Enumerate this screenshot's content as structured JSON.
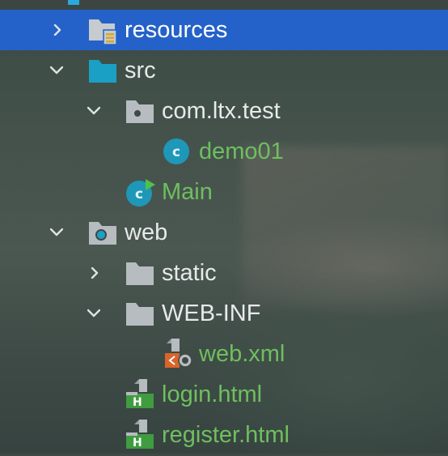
{
  "tree": {
    "items": [
      {
        "label": "resources",
        "icon": "resources-folder-icon",
        "color": "#ffffff",
        "expand": "collapsed",
        "selected": true
      },
      {
        "label": "src",
        "icon": "source-folder-icon",
        "color": "#e7e9ea",
        "expand": "expanded"
      },
      {
        "label": "com.ltx.test",
        "icon": "package-icon",
        "color": "#e7e9ea",
        "expand": "expanded"
      },
      {
        "label": "demo01",
        "icon": "class-icon",
        "color": "#6fbf5f",
        "expand": "none"
      },
      {
        "label": "Main",
        "icon": "main-class-icon",
        "color": "#6fbf5f",
        "expand": "none"
      },
      {
        "label": "web",
        "icon": "web-folder-icon",
        "color": "#e7e9ea",
        "expand": "expanded"
      },
      {
        "label": "static",
        "icon": "folder-icon",
        "color": "#e7e9ea",
        "expand": "collapsed"
      },
      {
        "label": "WEB-INF",
        "icon": "folder-icon",
        "color": "#e7e9ea",
        "expand": "expanded"
      },
      {
        "label": "web.xml",
        "icon": "xml-file-icon",
        "color": "#6fbf5f",
        "expand": "none"
      },
      {
        "label": "login.html",
        "icon": "html-file-icon",
        "color": "#6fbf5f",
        "expand": "none"
      },
      {
        "label": "register.html",
        "icon": "html-file-icon",
        "color": "#6fbf5f",
        "expand": "none"
      }
    ]
  },
  "colors": {
    "selection": "#2462c9",
    "folder": "#b7bcc0",
    "source_folder": "#1aa0c4",
    "class_circle": "#1f97b8",
    "vcs_added_text": "#6fbf5f",
    "html_badge": "#3f9c3f",
    "xml_badge": "#d9652b"
  }
}
